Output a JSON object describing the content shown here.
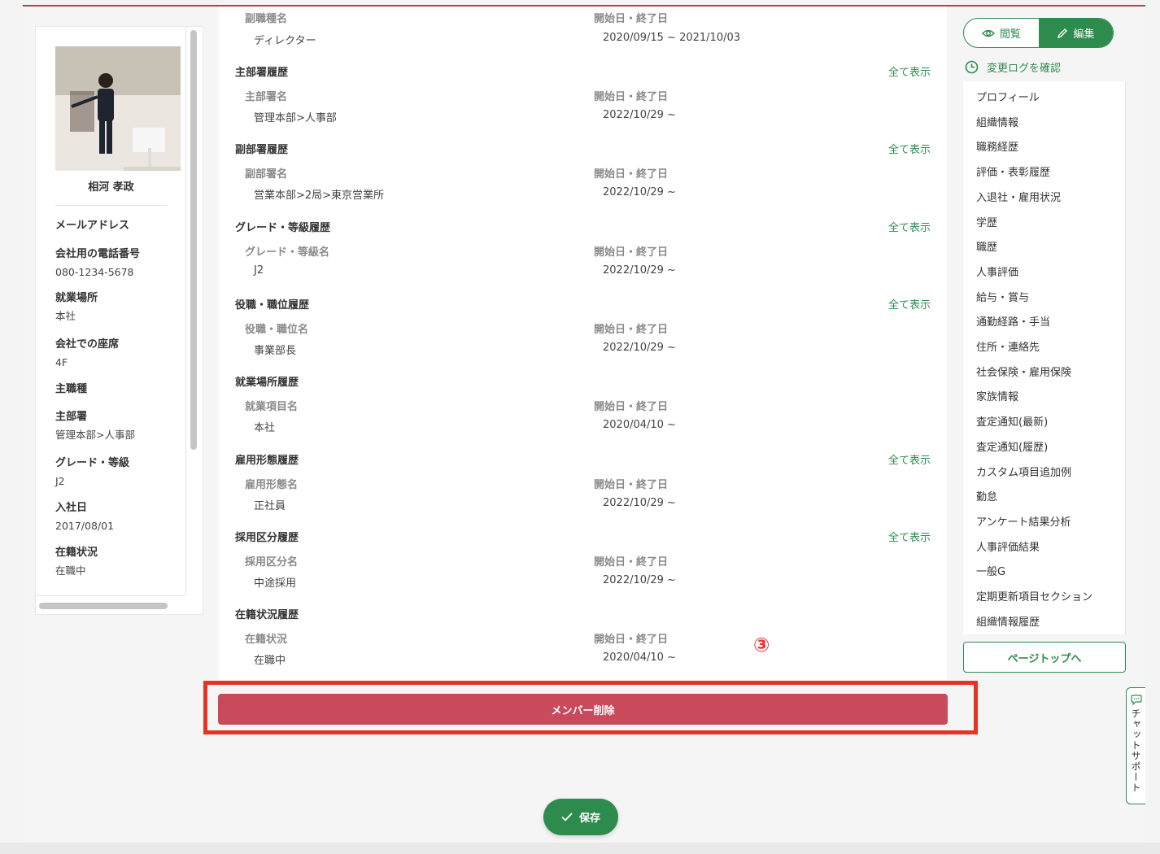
{
  "profile": {
    "name": "相河 孝政",
    "fields": [
      {
        "label": "メールアドレス",
        "value": ""
      },
      {
        "label": "会社用の電話番号",
        "value": "080-1234-5678"
      },
      {
        "label": "就業場所",
        "value": "本社"
      },
      {
        "label": "会社での座席",
        "value": "4F"
      },
      {
        "label": "主職種",
        "value": ""
      },
      {
        "label": "主部署",
        "value": "管理本部>人事部"
      },
      {
        "label": "グレード・等級",
        "value": "J2"
      },
      {
        "label": "入社日",
        "value": "2017/08/01"
      },
      {
        "label": "在籍状況",
        "value": "在職中"
      }
    ]
  },
  "date_header": "開始日・終了日",
  "show_all": "全て表示",
  "top_row": {
    "col_label": "副職種名",
    "value": "ディレクター",
    "dates": "2020/09/15 ~ 2021/10/03"
  },
  "sections": [
    {
      "title": "主部署履歴",
      "col_label": "主部署名",
      "value": "管理本部>人事部",
      "dates": "2022/10/29 ~",
      "show_all": true
    },
    {
      "title": "副部署履歴",
      "col_label": "副部署名",
      "value": "営業本部>2局>東京営業所",
      "dates": "2022/10/29 ~",
      "show_all": true
    },
    {
      "title": "グレード・等級履歴",
      "col_label": "グレード・等級名",
      "value": "J2",
      "dates": "2022/10/29 ~",
      "show_all": true
    },
    {
      "title": "役職・職位履歴",
      "col_label": "役職・職位名",
      "value": "事業部長",
      "dates": "2022/10/29 ~",
      "show_all": true
    },
    {
      "title": "就業場所履歴",
      "col_label": "就業項目名",
      "value": "本社",
      "dates": "2020/04/10 ~",
      "show_all": false
    },
    {
      "title": "雇用形態履歴",
      "col_label": "雇用形態名",
      "value": "正社員",
      "dates": "2022/10/29 ~",
      "show_all": true
    },
    {
      "title": "採用区分履歴",
      "col_label": "採用区分名",
      "value": "中途採用",
      "dates": "2022/10/29 ~",
      "show_all": true
    },
    {
      "title": "在籍状況履歴",
      "col_label": "在籍状況",
      "value": "在職中",
      "dates": "2020/04/10 ~",
      "show_all": false
    }
  ],
  "mode": {
    "view_label": "閲覧",
    "edit_label": "編集"
  },
  "changelog_label": "変更ログを確認",
  "nav_items": [
    "プロフィール",
    "組織情報",
    "職務経歴",
    "評価・表彰履歴",
    "入退社・雇用状況",
    "学歴",
    "職歴",
    "人事評価",
    "給与・賞与",
    "通勤経路・手当",
    "住所・連絡先",
    "社会保険・雇用保険",
    "家族情報",
    "査定通知(最新)",
    "査定通知(履歴)",
    "カスタム項目追加例",
    "勤怠",
    "アンケート結果分析",
    "人事評価結果",
    "一般G",
    "定期更新項目セクション",
    "組織情報履歴"
  ],
  "page_top_label": "ページトップへ",
  "annotation_marker": "③",
  "delete_label": "メンバー削除",
  "chat_label": "チャットサポート",
  "save_label": "保存",
  "colors": {
    "accent_green": "#2e8b4e",
    "delete_red": "#c84a5b",
    "highlight_red": "#e53324"
  }
}
